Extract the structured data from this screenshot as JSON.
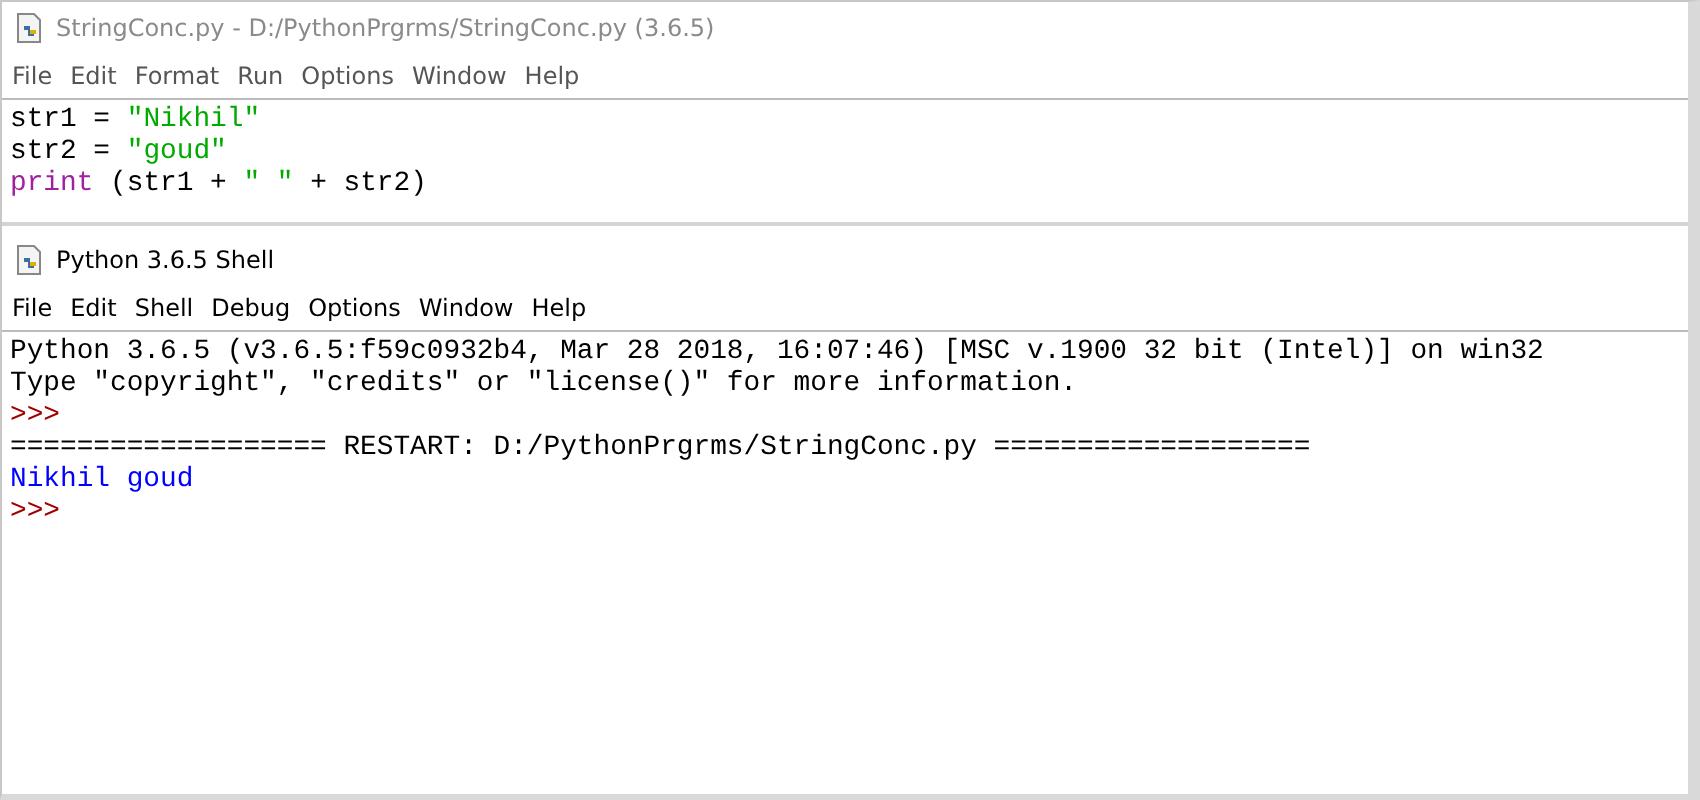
{
  "editor": {
    "title": "StringConc.py - D:/PythonPrgrms/StringConc.py (3.6.5)",
    "menu": [
      "File",
      "Edit",
      "Format",
      "Run",
      "Options",
      "Window",
      "Help"
    ],
    "lines": [
      [
        {
          "kind": "plain",
          "text": "str1 = "
        },
        {
          "kind": "string",
          "text": "\"Nikhil\""
        }
      ],
      [
        {
          "kind": "plain",
          "text": "str2 = "
        },
        {
          "kind": "string",
          "text": "\"goud\""
        }
      ],
      [
        {
          "kind": "keyword",
          "text": "print"
        },
        {
          "kind": "plain",
          "text": " (str1 + "
        },
        {
          "kind": "string",
          "text": "\" \""
        },
        {
          "kind": "plain",
          "text": " + str2)"
        }
      ]
    ]
  },
  "shell": {
    "title": "Python 3.6.5 Shell",
    "menu": [
      "File",
      "Edit",
      "Shell",
      "Debug",
      "Options",
      "Window",
      "Help"
    ],
    "lines": [
      {
        "kind": "output",
        "text": "Python 3.6.5 (v3.6.5:f59c0932b4, Mar 28 2018, 16:07:46) [MSC v.1900 32 bit (Intel)] on win32"
      },
      {
        "kind": "output",
        "text": "Type \"copyright\", \"credits\" or \"license()\" for more information."
      },
      {
        "kind": "prompt",
        "text": ">>>"
      },
      {
        "kind": "output",
        "text": "=================== RESTART: D:/PythonPrgrms/StringConc.py ==================="
      },
      {
        "kind": "stdout",
        "text": "Nikhil goud"
      },
      {
        "kind": "prompt",
        "text": ">>>"
      }
    ]
  }
}
